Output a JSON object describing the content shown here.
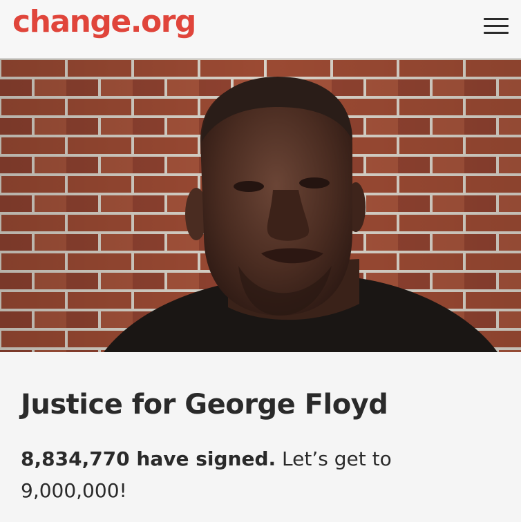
{
  "header": {
    "logo_text": "change.org",
    "menu_icon": "hamburger-menu-icon"
  },
  "hero": {
    "image_description": "man-portrait-photo"
  },
  "petition": {
    "title": "Justice for George Floyd",
    "signed_count": "8,834,770 have signed.",
    "goal_text": "Let’s get to 9,000,000!"
  },
  "colors": {
    "brand": "#e0453b",
    "text": "#2a2a2a",
    "background": "#f5f5f5"
  }
}
